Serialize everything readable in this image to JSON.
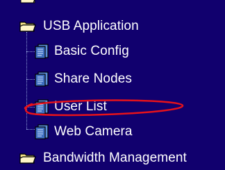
{
  "tree": {
    "folders": [
      {
        "label": "USB Application",
        "icon": "folder-icon"
      },
      {
        "label": "Bandwidth Management",
        "icon": "folder-icon"
      }
    ],
    "usb_children": [
      {
        "label": "Basic Config",
        "icon": "document-icon"
      },
      {
        "label": "Share Nodes",
        "icon": "document-icon"
      },
      {
        "label": "User List",
        "icon": "document-icon",
        "highlighted": true
      },
      {
        "label": "Web Camera",
        "icon": "document-icon"
      }
    ]
  },
  "colors": {
    "background": "#11006e",
    "text": "#ffffff",
    "highlight_ellipse": "#e8121a",
    "folder_icon": "#f2df86",
    "document_icon": "#5a8fd8"
  }
}
